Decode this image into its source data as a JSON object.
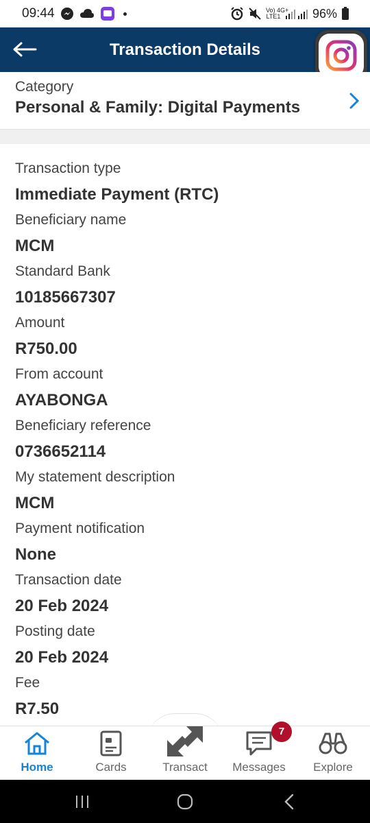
{
  "status_bar": {
    "time": "09:44",
    "network_label": "Vo) 4G+\nLTE1",
    "battery": "96%"
  },
  "header": {
    "title": "Transaction Details"
  },
  "category": {
    "label": "Category",
    "value": "Personal & Family: Digital Payments"
  },
  "details": [
    {
      "label": "Transaction type",
      "value": "Immediate Payment (RTC)"
    },
    {
      "label": "Beneficiary name",
      "value": "MCM"
    },
    {
      "label": "Standard Bank",
      "value": "10185667307"
    },
    {
      "label": "Amount",
      "value": "R750.00"
    },
    {
      "label": "From account",
      "value": "AYABONGA"
    },
    {
      "label": "Beneficiary reference",
      "value": "0736652114"
    },
    {
      "label": "My statement description",
      "value": "MCM"
    },
    {
      "label": "Payment notification",
      "value": "None"
    },
    {
      "label": "Transaction date",
      "value": "20 Feb 2024"
    },
    {
      "label": "Posting date",
      "value": "20 Feb 2024"
    },
    {
      "label": "Fee",
      "value": "R7.50"
    }
  ],
  "bottom_nav": {
    "items": [
      {
        "label": "Home",
        "icon": "home-icon",
        "active": true
      },
      {
        "label": "Cards",
        "icon": "cards-icon",
        "active": false
      },
      {
        "label": "Transact",
        "icon": "transact-icon",
        "active": false
      },
      {
        "label": "Messages",
        "icon": "messages-icon",
        "active": false
      },
      {
        "label": "Explore",
        "icon": "binoculars-icon",
        "active": false
      }
    ],
    "messages_badge": "7"
  },
  "colors": {
    "header_bg": "#0b3a67",
    "accent": "#1483d8",
    "badge": "#b0102a"
  }
}
